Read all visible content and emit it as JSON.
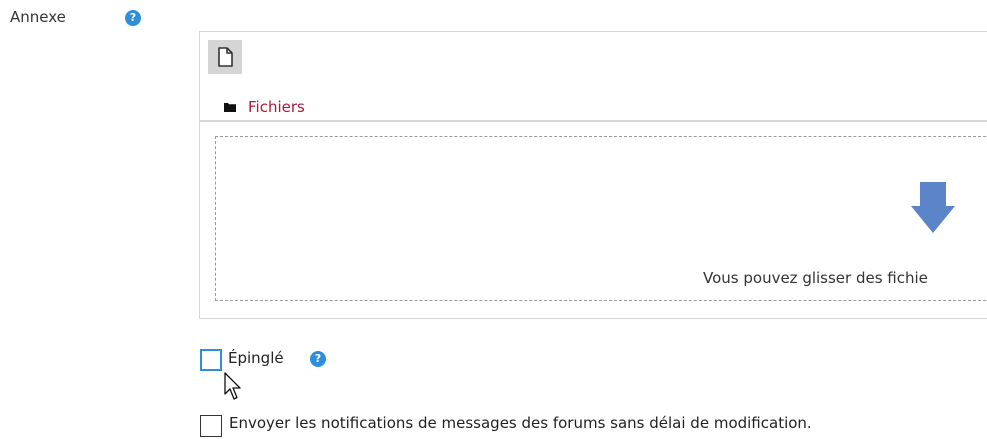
{
  "form": {
    "annexe_label": "Annexe",
    "help_glyph": "?"
  },
  "filemanager": {
    "toolbar_icon": "new-file-icon",
    "path_icon": "folder-icon",
    "path_link": "Fichiers",
    "dropzone_icon": "down-arrow-icon",
    "dropzone_message": "Vous pouvez glisser des fichie"
  },
  "options": {
    "pinned_label": "Épinglé",
    "pinned_checked": false,
    "notify_label": "Envoyer les notifications de messages des forums sans délai de modification.",
    "notify_checked": false
  },
  "colors": {
    "link": "#b0173a",
    "help": "#2d8fdc",
    "arrow": "#5b84c9",
    "focus": "#2d8fdc"
  }
}
